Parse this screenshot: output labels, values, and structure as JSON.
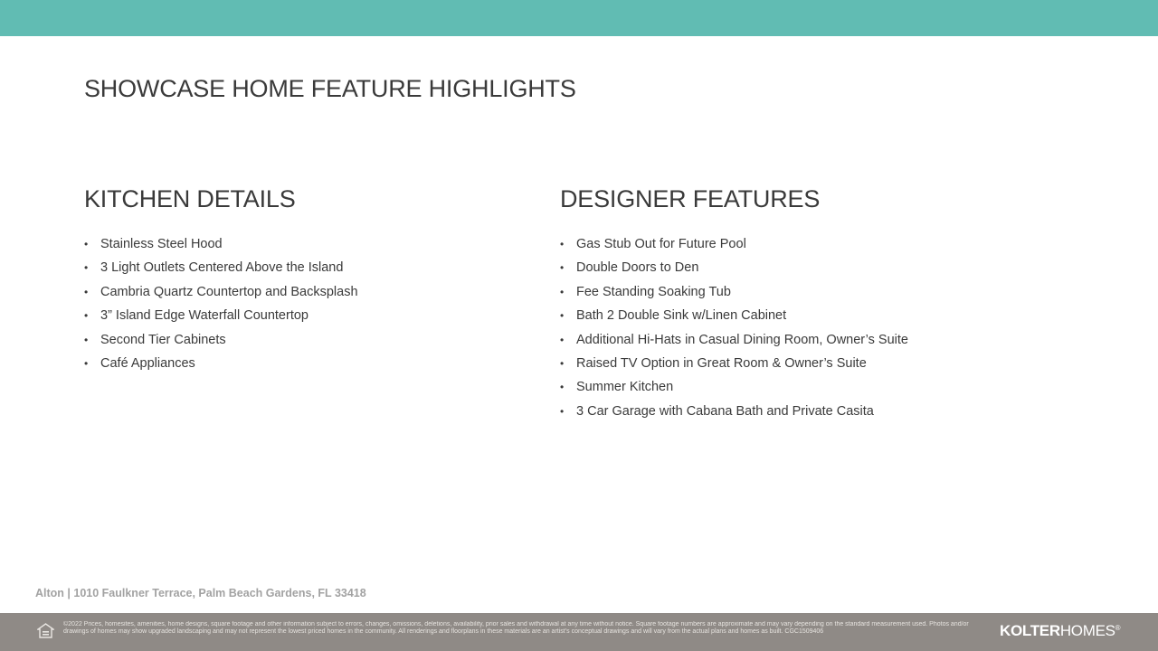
{
  "colors": {
    "top_band": "#61bcb3",
    "footer_band": "#8f8a86",
    "text": "#3a3a3a"
  },
  "page": {
    "title": "SHOWCASE HOME FEATURE HIGHLIGHTS"
  },
  "kitchen": {
    "title": "KITCHEN DETAILS",
    "items": [
      "Stainless Steel Hood",
      "3 Light Outlets Centered Above the Island",
      "Cambria Quartz Countertop and Backsplash",
      "3” Island Edge Waterfall Countertop",
      "Second Tier Cabinets",
      "Café Appliances"
    ]
  },
  "designer": {
    "title": "DESIGNER FEATURES",
    "items": [
      "Gas Stub Out for Future Pool",
      "Double Doors to Den",
      "Fee Standing Soaking Tub",
      "Bath 2 Double Sink w/Linen Cabinet",
      "Additional  Hi-Hats in Casual Dining Room, Owner’s Suite",
      "Raised TV Option in Great Room & Owner’s Suite",
      "Summer Kitchen",
      "3 Car Garage with Cabana Bath and Private Casita"
    ]
  },
  "bullet_char": "•",
  "address": "Alton | 1010 Faulkner Terrace, Palm Beach Gardens, FL 33418",
  "footer": {
    "disclaimer": "©2022 Prices, homesites, amenities, home designs, square footage and other information subject to errors, changes, omissions, deletions, availability, prior sales and withdrawal at any time without notice. Square footage numbers are approximate and may vary depending on the standard measurement used. Photos and/or drawings of homes may show upgraded landscaping and may not represent the lowest priced homes in the community. All renderings and floorplans in these materials are an artist’s conceptual drawings and will vary from the actual plans and homes as built. CGC1509406",
    "brand_bold": "KOLTER",
    "brand_light": "HOMES",
    "brand_mark": "®",
    "icon": "equal-housing-opportunity-icon"
  }
}
